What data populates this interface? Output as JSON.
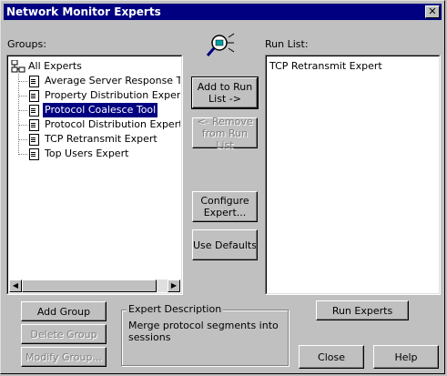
{
  "window": {
    "title": "Network Monitor Experts",
    "close_glyph": "✕"
  },
  "groups": {
    "label": "Groups:",
    "tree": [
      {
        "label": "All Experts",
        "icon": "network-group-icon",
        "selected": false
      },
      {
        "label": "Average Server Response Time",
        "icon": "document-icon",
        "selected": false
      },
      {
        "label": "Property Distribution Expert",
        "icon": "document-icon",
        "selected": false
      },
      {
        "label": "Protocol Coalesce Tool",
        "icon": "document-icon",
        "selected": true
      },
      {
        "label": "Protocol Distribution Expert",
        "icon": "document-icon",
        "selected": false
      },
      {
        "label": "TCP Retransmit Expert",
        "icon": "document-icon",
        "selected": false
      },
      {
        "label": "Top Users Expert",
        "icon": "document-icon",
        "selected": false
      }
    ],
    "scroll_left": "◀",
    "scroll_right": "▶"
  },
  "center": {
    "icon": "expert-magnifier-icon",
    "add_to_run_list": "Add to Run List ->",
    "remove_from_run_list": "<- Remove from Run List",
    "configure_expert": "Configure Expert...",
    "use_defaults": "Use Defaults"
  },
  "run_list": {
    "label": "Run List:",
    "items": [
      "TCP Retransmit Expert"
    ]
  },
  "group_buttons": {
    "add_group": "Add Group",
    "delete_group": "Delete Group",
    "modify_group": "Modify Group..."
  },
  "description": {
    "label": "Expert Description",
    "text": "Merge protocol segments into sessions"
  },
  "bottom_buttons": {
    "run_experts": "Run Experts",
    "close": "Close",
    "help": "Help"
  },
  "colors": {
    "face": "#c0c0c0",
    "titlebar": "#000080",
    "selection": "#000080"
  }
}
